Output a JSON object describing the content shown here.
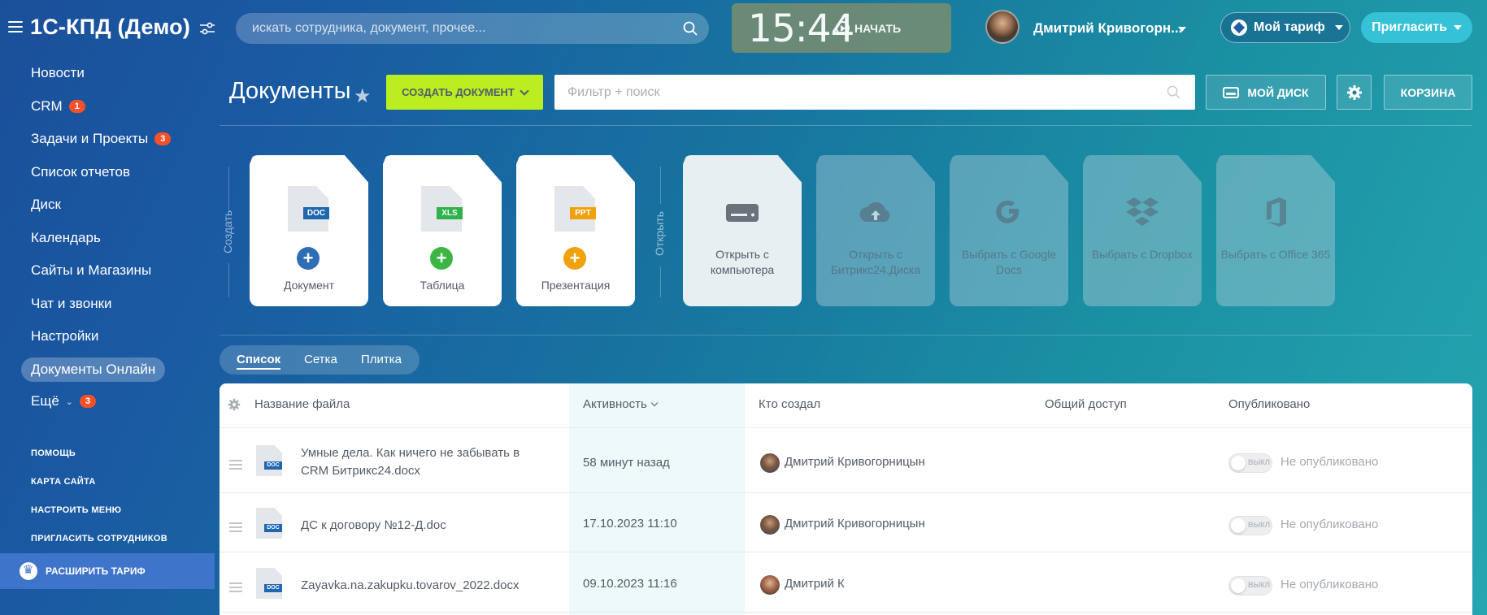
{
  "topbar": {
    "logo": "1С-КПД (Демо)",
    "search_placeholder": "искать сотрудника, документ, прочее...",
    "clock": "15:44",
    "start_label": "НАЧАТЬ",
    "user_name": "Дмитрий Кривогорн...",
    "tariff_label": "Мой тариф",
    "invite_label": "Пригласить"
  },
  "sidebar": {
    "items": [
      {
        "label": "Новости",
        "badge": ""
      },
      {
        "label": "CRM",
        "badge": "1"
      },
      {
        "label": "Задачи и Проекты",
        "badge": "3"
      },
      {
        "label": "Список отчетов",
        "badge": ""
      },
      {
        "label": "Диск",
        "badge": ""
      },
      {
        "label": "Календарь",
        "badge": ""
      },
      {
        "label": "Сайты и Магазины",
        "badge": ""
      },
      {
        "label": "Чат и звонки",
        "badge": ""
      },
      {
        "label": "Настройки",
        "badge": ""
      },
      {
        "label": "Документы Онлайн",
        "badge": ""
      },
      {
        "label": "Ещё",
        "badge": "3"
      }
    ],
    "small_links": [
      "ПОМОЩЬ",
      "КАРТА САЙТА",
      "НАСТРОИТЬ МЕНЮ",
      "ПРИГЛАСИТЬ СОТРУДНИКОВ"
    ],
    "upgrade_label": "РАСШИРИТЬ ТАРИФ"
  },
  "header": {
    "title": "Документы",
    "create_label": "СОЗДАТЬ ДОКУМЕНТ",
    "filter_placeholder": "Фильтр + поиск",
    "disk_label": "МОЙ ДИСК",
    "trash_label": "КОРЗИНА"
  },
  "tiles": {
    "create_group_label": "Создать",
    "open_group_label": "Открыть",
    "create": [
      {
        "label": "Документ",
        "tag": "DOC",
        "tag_color": "#2067b0",
        "plus_color": "#2f6db5"
      },
      {
        "label": "Таблица",
        "tag": "XLS",
        "tag_color": "#2fb14b",
        "plus_color": "#3cb545"
      },
      {
        "label": "Презентация",
        "tag": "PPT",
        "tag_color": "#f0a20e",
        "plus_color": "#f0a20e"
      }
    ],
    "open": [
      {
        "label": "Открыть с компьютера",
        "icon": "drive-icon"
      },
      {
        "label": "Открыть с Битрикс24.Диска",
        "icon": "cloud-upload-icon"
      },
      {
        "label": "Выбрать с Google Docs",
        "icon": "google-icon"
      },
      {
        "label": "Выбрать с Dropbox",
        "icon": "dropbox-icon"
      },
      {
        "label": "Выбрать с Office 365",
        "icon": "office-icon"
      }
    ]
  },
  "view_tabs": [
    "Список",
    "Сетка",
    "Плитка"
  ],
  "table": {
    "columns": [
      "Название файла",
      "Активность",
      "Кто создал",
      "Общий доступ",
      "Опубликовано"
    ],
    "rows": [
      {
        "name": "Умные дела. Как ничего не забывать в CRM Битрикс24.docx",
        "activity": "58 минут назад",
        "author": "Дмитрий Кривогорницын",
        "toggle": "ВЫКЛ",
        "published": "Не опубликовано"
      },
      {
        "name": "ДС к договору №12-Д.doc",
        "activity": "17.10.2023 11:10",
        "author": "Дмитрий Кривогорницын",
        "toggle": "ВЫКЛ",
        "published": "Не опубликовано"
      },
      {
        "name": "Zayavka.na.zakupku.tovarov_2022.docx",
        "activity": "09.10.2023 11:16",
        "author": "Дмитрий К",
        "toggle": "ВЫКЛ",
        "published": "Не опубликовано"
      }
    ],
    "doc_tag": "DOC"
  }
}
